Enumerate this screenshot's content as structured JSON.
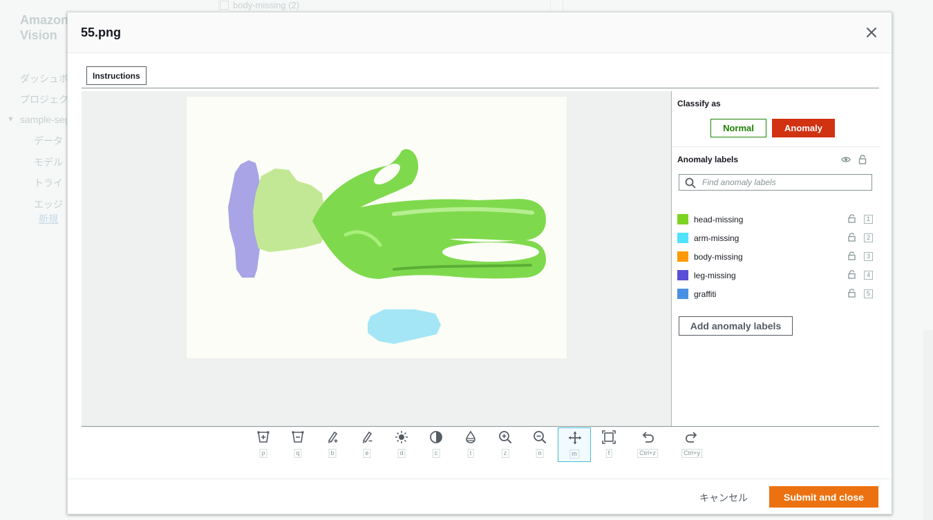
{
  "background": {
    "brand": "Amazon\nVision",
    "nav": [
      "ダッシュボ",
      "プロジェク",
      "sample-seg",
      "データ",
      "モデル",
      "トライ",
      "エッジ",
      "新規"
    ],
    "top_row_text": "body-missing (2)"
  },
  "modal": {
    "title": "55.png",
    "instructions_label": "Instructions",
    "cancel_label": "キャンセル",
    "submit_label": "Submit and close"
  },
  "classify": {
    "title": "Classify as",
    "normal_label": "Normal",
    "anomaly_label": "Anomaly",
    "selected": "Anomaly"
  },
  "anomaly_labels": {
    "title": "Anomaly labels",
    "search_placeholder": "Find anomaly labels",
    "add_label": "Add anomaly labels",
    "items": [
      {
        "name": "head-missing",
        "color": "#7ed321",
        "key": "1"
      },
      {
        "name": "arm-missing",
        "color": "#50e3ff",
        "key": "2"
      },
      {
        "name": "body-missing",
        "color": "#ff9900",
        "key": "3"
      },
      {
        "name": "leg-missing",
        "color": "#5a4fd6",
        "key": "4"
      },
      {
        "name": "graffiti",
        "color": "#4a90e2",
        "key": "5"
      }
    ]
  },
  "toolbar": {
    "tools": [
      {
        "name": "polygon-add",
        "key": "p"
      },
      {
        "name": "polygon-subtract",
        "key": "q"
      },
      {
        "name": "brush-add",
        "key": "b"
      },
      {
        "name": "brush-erase",
        "key": "e"
      },
      {
        "name": "brightness",
        "key": "d"
      },
      {
        "name": "contrast",
        "key": "c"
      },
      {
        "name": "transparency",
        "key": "t"
      },
      {
        "name": "zoom-in",
        "key": "z"
      },
      {
        "name": "zoom-out",
        "key": "o"
      },
      {
        "name": "move",
        "key": "m",
        "active": true
      },
      {
        "name": "fit-screen",
        "key": "f"
      },
      {
        "name": "undo",
        "key": "Ctrl+z"
      },
      {
        "name": "redo",
        "key": "Ctrl+y"
      }
    ]
  }
}
